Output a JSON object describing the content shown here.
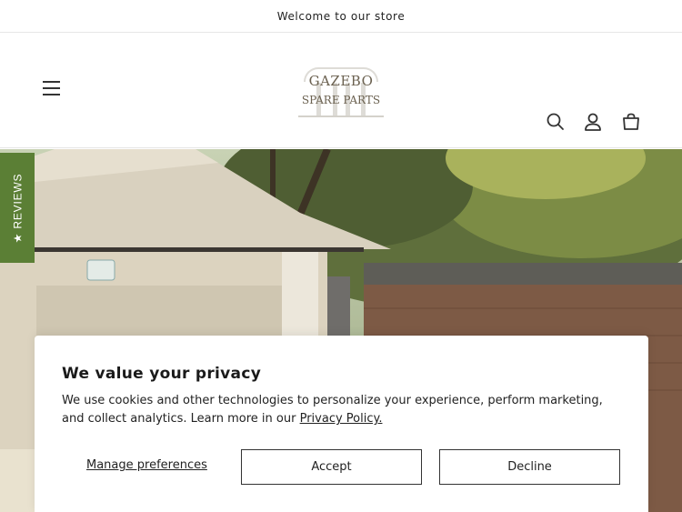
{
  "announcement": {
    "text": "Welcome to our store"
  },
  "header": {
    "logo_line1": "GAZEBO",
    "logo_line2": "SPARE PARTS",
    "icons": [
      "menu-icon",
      "search-icon",
      "account-icon",
      "cart-icon"
    ]
  },
  "reviews_tab": {
    "label": "★ REVIEWS",
    "color": "#5b7f35"
  },
  "cookie": {
    "title": "We value your privacy",
    "body": "We use cookies and other technologies to personalize your experience, perform marketing, and collect analytics. Learn more in our ",
    "policy_link": "Privacy Policy.",
    "manage_label": "Manage preferences",
    "accept_label": "Accept",
    "decline_label": "Decline"
  }
}
